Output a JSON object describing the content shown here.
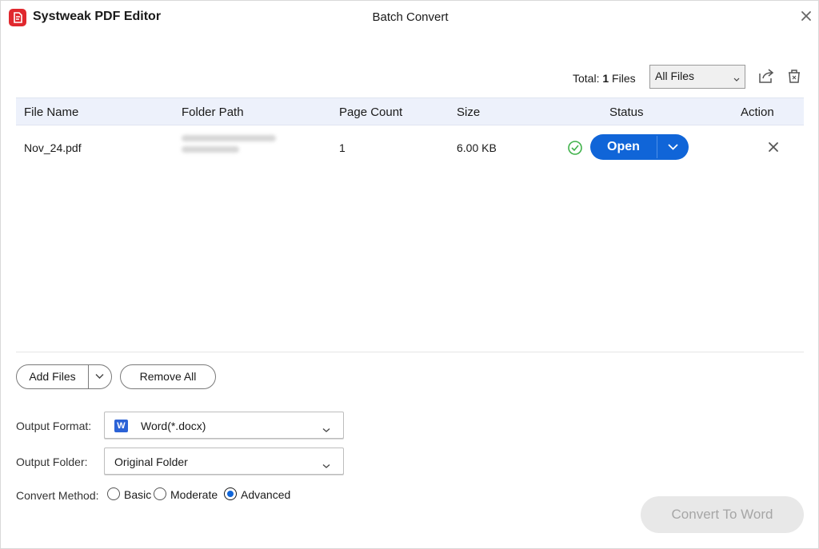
{
  "app": {
    "name": "Systweak PDF Editor",
    "dialog_title": "Batch Convert",
    "accent": "#1065d8",
    "logo_color": "#e0282e"
  },
  "toolbar": {
    "total_label": "Total:",
    "total_count": "1",
    "total_suffix": "Files",
    "filter_value": "All Files",
    "share_icon": "share-export-icon",
    "trash_icon": "trash-icon"
  },
  "table": {
    "columns": [
      "File Name",
      "Folder Path",
      "Page Count",
      "Size",
      "Status",
      "Action"
    ],
    "rows": [
      {
        "file_name": "Nov_24.pdf",
        "folder_path": "",
        "page_count": "1",
        "size": "6.00 KB",
        "status": "success",
        "open_label": "Open"
      }
    ]
  },
  "actions": {
    "add_files": "Add Files",
    "remove_all": "Remove All"
  },
  "settings": {
    "output_format_label": "Output Format:",
    "output_format_value": "Word(*.docx)",
    "output_format_icon": "W",
    "output_folder_label": "Output Folder:",
    "output_folder_value": "Original Folder",
    "convert_method_label": "Convert Method:",
    "methods": [
      "Basic",
      "Moderate",
      "Advanced"
    ],
    "selected_method": "Advanced"
  },
  "convert_button": "Convert To Word"
}
